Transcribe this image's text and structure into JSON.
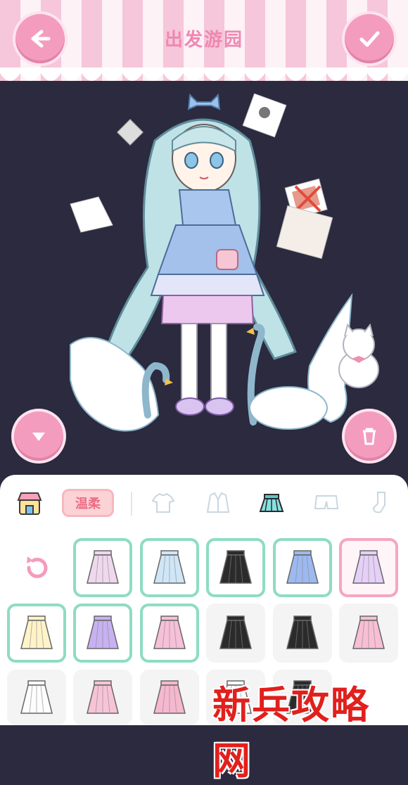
{
  "header": {
    "title": "出发游园"
  },
  "buttons": {
    "back_icon": "arrow-left",
    "confirm_icon": "check",
    "collapse_icon": "triangle-down",
    "trash_icon": "trash"
  },
  "colors": {
    "accent_pink": "#f49cbe",
    "owned_border": "#8edcc3",
    "selected_border": "#f4a6c3",
    "stage_bg": "#2b2a3f"
  },
  "category_bar": {
    "shop_icon": "shop-icon",
    "style_tag": "温柔",
    "categories": [
      "shirt",
      "jacket",
      "skirt",
      "shorts",
      "sock"
    ],
    "active_category": "skirt"
  },
  "grid": {
    "reset_icon": "reset-icon",
    "items": [
      {
        "id": "skirt-1",
        "state": "owned"
      },
      {
        "id": "skirt-2",
        "state": "owned"
      },
      {
        "id": "skirt-3",
        "state": "owned"
      },
      {
        "id": "skirt-4",
        "state": "owned"
      },
      {
        "id": "skirt-5",
        "state": "selected"
      },
      {
        "id": "skirt-6",
        "state": "owned"
      },
      {
        "id": "skirt-7",
        "state": "owned"
      },
      {
        "id": "skirt-8",
        "state": "owned"
      },
      {
        "id": "skirt-9",
        "state": "locked"
      },
      {
        "id": "skirt-10",
        "state": "locked"
      },
      {
        "id": "skirt-11",
        "state": "locked"
      },
      {
        "id": "skirt-12",
        "state": "locked"
      },
      {
        "id": "skirt-13",
        "state": "locked"
      },
      {
        "id": "skirt-14",
        "state": "locked"
      },
      {
        "id": "skirt-15",
        "state": "locked"
      },
      {
        "id": "skirt-16",
        "state": "locked"
      }
    ]
  },
  "watermark": "新兵攻略网"
}
